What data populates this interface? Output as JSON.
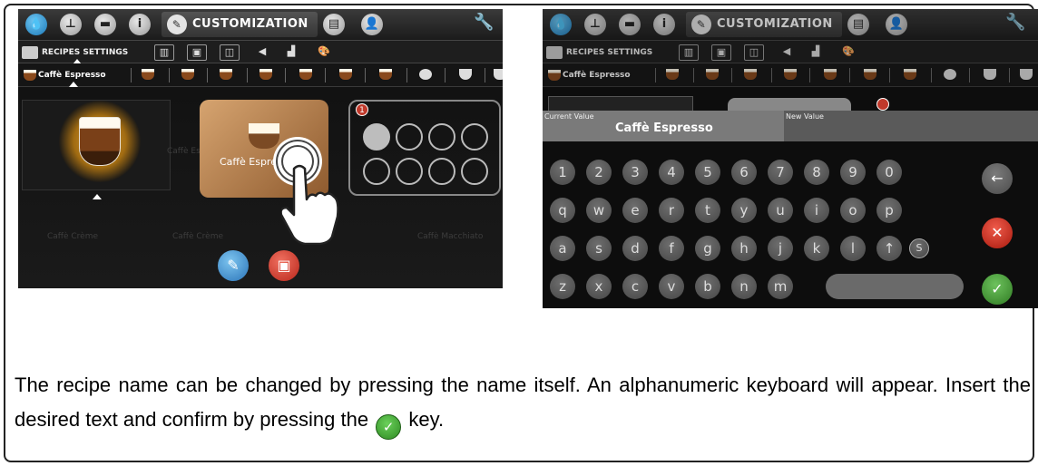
{
  "screen1": {
    "tab_title": "CUSTOMIZATION",
    "recipes_label": "RECIPES SETTINGS",
    "selected_recipe": "Caffè Espresso",
    "card_label": "Caffè Espre",
    "slot_badge": "1",
    "dim_labels": [
      "Caffè Crème",
      "Caffè Crème",
      "Caffè Macchiato",
      "Caffè Espresso"
    ]
  },
  "screen2": {
    "tab_title": "CUSTOMIZATION",
    "recipes_label": "RECIPES SETTINGS",
    "selected_recipe": "Caffè Espresso",
    "current_value_label": "Current Value",
    "current_value": "Caffè Espresso",
    "new_value_label": "New Value",
    "rows": [
      [
        "1",
        "2",
        "3",
        "4",
        "5",
        "6",
        "7",
        "8",
        "9",
        "0"
      ],
      [
        "q",
        "w",
        "e",
        "r",
        "t",
        "y",
        "u",
        "i",
        "o",
        "p"
      ],
      [
        "a",
        "s",
        "d",
        "f",
        "g",
        "h",
        "j",
        "k",
        "l",
        "↑",
        "S"
      ],
      [
        "z",
        "x",
        "c",
        "v",
        "b",
        "n",
        "m"
      ]
    ],
    "backspace": "←",
    "cancel": "✕",
    "confirm": "✓"
  },
  "caption": {
    "text1": "The recipe name can be changed by pressing the name itself. An alphanumeric keyboard will appear. Insert the desired text and confirm by pressing the",
    "text2": "key.",
    "ok_glyph": "✓"
  },
  "colors": {
    "confirm_green": "#3f9a33",
    "cancel_red": "#c0392b",
    "action_blue": "#2b74b8"
  }
}
